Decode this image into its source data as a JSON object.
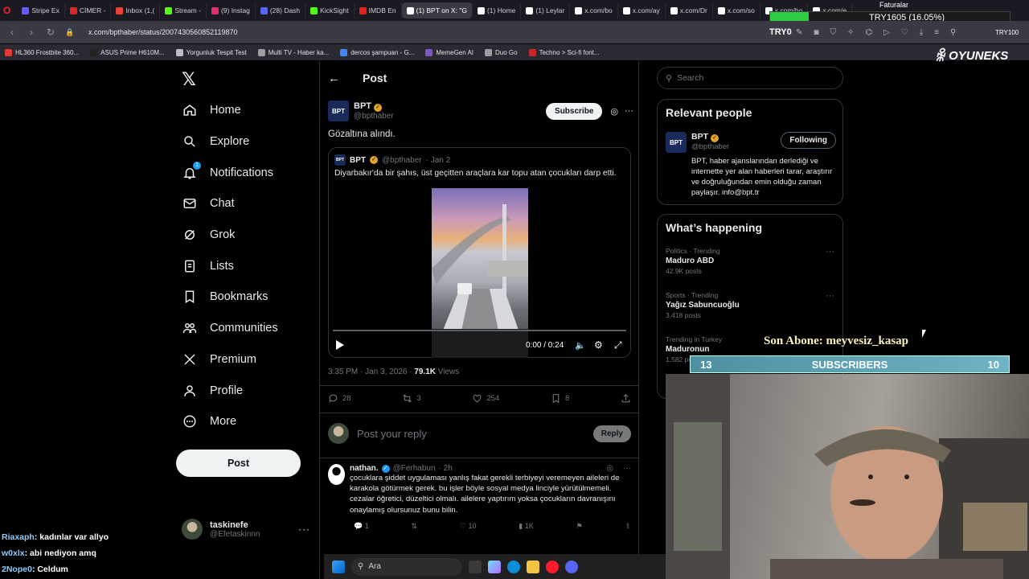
{
  "browser": {
    "tabs": [
      {
        "label": "Stripe Ex",
        "color": "#635bff"
      },
      {
        "label": "CİMER -",
        "color": "#d62828"
      },
      {
        "label": "Inbox (1,(",
        "color": "#ea4335"
      },
      {
        "label": "Stream -",
        "color": "#53fc18"
      },
      {
        "label": "(9) Instag",
        "color": "#e1306c"
      },
      {
        "label": "(28) Dash",
        "color": "#5865f2"
      },
      {
        "label": "KickSight",
        "color": "#53fc18"
      },
      {
        "label": "IMDB En",
        "color": "#e62117"
      },
      {
        "label": "(1) BPT on X: \"G",
        "color": "#ffffff",
        "active": true
      },
      {
        "label": "(1) Home",
        "color": "#ffffff"
      },
      {
        "label": "(1) Leylar",
        "color": "#ffffff"
      },
      {
        "label": "x.com/bo",
        "color": "#ffffff"
      },
      {
        "label": "x.com/ay",
        "color": "#ffffff"
      },
      {
        "label": "x.com/Dr",
        "color": "#ffffff"
      },
      {
        "label": "x.com/so",
        "color": "#ffffff"
      },
      {
        "label": "x.com/ho",
        "color": "#ffffff"
      },
      {
        "label": "x.com/e",
        "color": "#ffffff"
      }
    ],
    "url": "x.com/bpthaber/status/2007430560852119870",
    "bookmarks": [
      {
        "label": "HL360 Frostbite 360...",
        "color": "#e53935"
      },
      {
        "label": "ASUS Prime H610M...",
        "color": "#222222"
      },
      {
        "label": "Yorgunluk Tespit Test",
        "color": "#bdbdbd"
      },
      {
        "label": "Multi TV - Haber ka...",
        "color": "#9e9e9e"
      },
      {
        "label": "dercos şampuan - G...",
        "color": "#4285f4"
      },
      {
        "label": "MemeGen AI",
        "color": "#7e57c2"
      },
      {
        "label": "Duo Go",
        "color": "#9e9e9e"
      },
      {
        "label": "Techno > Sci-fi font...",
        "color": "#c62828"
      }
    ]
  },
  "overlay": {
    "faturalar": "Faturalar",
    "try_label": "TRY1605 (16.05%)",
    "try_progress": 0.1605,
    "try0": "TRY0",
    "try_right": "TRY100",
    "brand": "OYUNEKS",
    "son_abone": "Son Abone: meyvesiz_kasap",
    "sub_left": "13",
    "sub_label": "SUBSCRIBERS",
    "sub_right": "10"
  },
  "chat": [
    {
      "user": "Riaxaph",
      "msg": ": kadınlar var allyo"
    },
    {
      "user": "w0xlx",
      "msg": ": abi nediyon amq"
    },
    {
      "user": "2Nope0",
      "msg": ": Celdum"
    }
  ],
  "sidebar": {
    "items": [
      {
        "label": "Home",
        "icon": "home-icon"
      },
      {
        "label": "Explore",
        "icon": "search-icon"
      },
      {
        "label": "Notifications",
        "icon": "bell-icon",
        "badge": "1"
      },
      {
        "label": "Chat",
        "icon": "mail-icon"
      },
      {
        "label": "Grok",
        "icon": "grok-icon"
      },
      {
        "label": "Lists",
        "icon": "list-icon"
      },
      {
        "label": "Bookmarks",
        "icon": "bookmark-icon"
      },
      {
        "label": "Communities",
        "icon": "people-icon"
      },
      {
        "label": "Premium",
        "icon": "x-icon"
      },
      {
        "label": "Profile",
        "icon": "person-icon"
      },
      {
        "label": "More",
        "icon": "more-circle-icon"
      }
    ],
    "post_label": "Post",
    "account": {
      "name": "taskinefe",
      "handle": "@Efetaskinnn"
    }
  },
  "post": {
    "header": "Post",
    "author": "BPT",
    "handle": "@bpthaber",
    "subscribe": "Subscribe",
    "text": "Gözaltına alındı.",
    "quote": {
      "author": "BPT",
      "handle": "@bpthaber",
      "date": "· Jan 2",
      "text": "Diyarbakır'da bir şahıs, üst geçitten araçlara kar topu atan çocukları darp etti.",
      "video_time": "0:00 / 0:24"
    },
    "meta_time": "3:35 PM · Jan 3, 2026 ·",
    "views": "79.1K",
    "views_label": "Views",
    "actions": {
      "replies": "28",
      "reposts": "3",
      "likes": "254",
      "bookmarks": "8"
    },
    "reply_placeholder": "Post your reply",
    "reply_button": "Reply"
  },
  "reply1": {
    "name": "nathan.",
    "handle": "@Ferhabun",
    "time": "· 2h",
    "text": "çocuklara şiddet uygulaması yanlış fakat gerekli terbiyeyi veremeyen aileleri de karakola götürmek gerek. bu işler böyle sosyal medya linciyle yürütülmemeli. cezalar öğretici, düzeltici olmalı. ailelere yaptırım yoksa çocukların davranışını onaylamış olursunuz bunu bilin.",
    "actions": {
      "replies": "1",
      "reposts": "",
      "likes": "10",
      "views": "1K"
    }
  },
  "right": {
    "search_placeholder": "Search",
    "relevant_title": "Relevant people",
    "person": {
      "name": "BPT",
      "handle": "@bpthaber",
      "follow": "Following",
      "bio": "BPT, haber ajanslarından derlediği ve internette yer alan haberleri tarar, araştırır ve doğruluğundan emin olduğu zaman paylaşır. info@bpt.tr"
    },
    "happening_title": "What’s happening",
    "trends": [
      {
        "cat": "Politics · Trending",
        "title": "Maduro ABD",
        "count": "42.9K posts"
      },
      {
        "cat": "Sports · Trending",
        "title": "Yağız Sabuncuoğlu",
        "count": "3,418 posts"
      },
      {
        "cat": "Trending in Turkey",
        "title": "Maduronun",
        "count": "1,582 posts"
      }
    ]
  },
  "taskbar": {
    "search": "Ara"
  }
}
